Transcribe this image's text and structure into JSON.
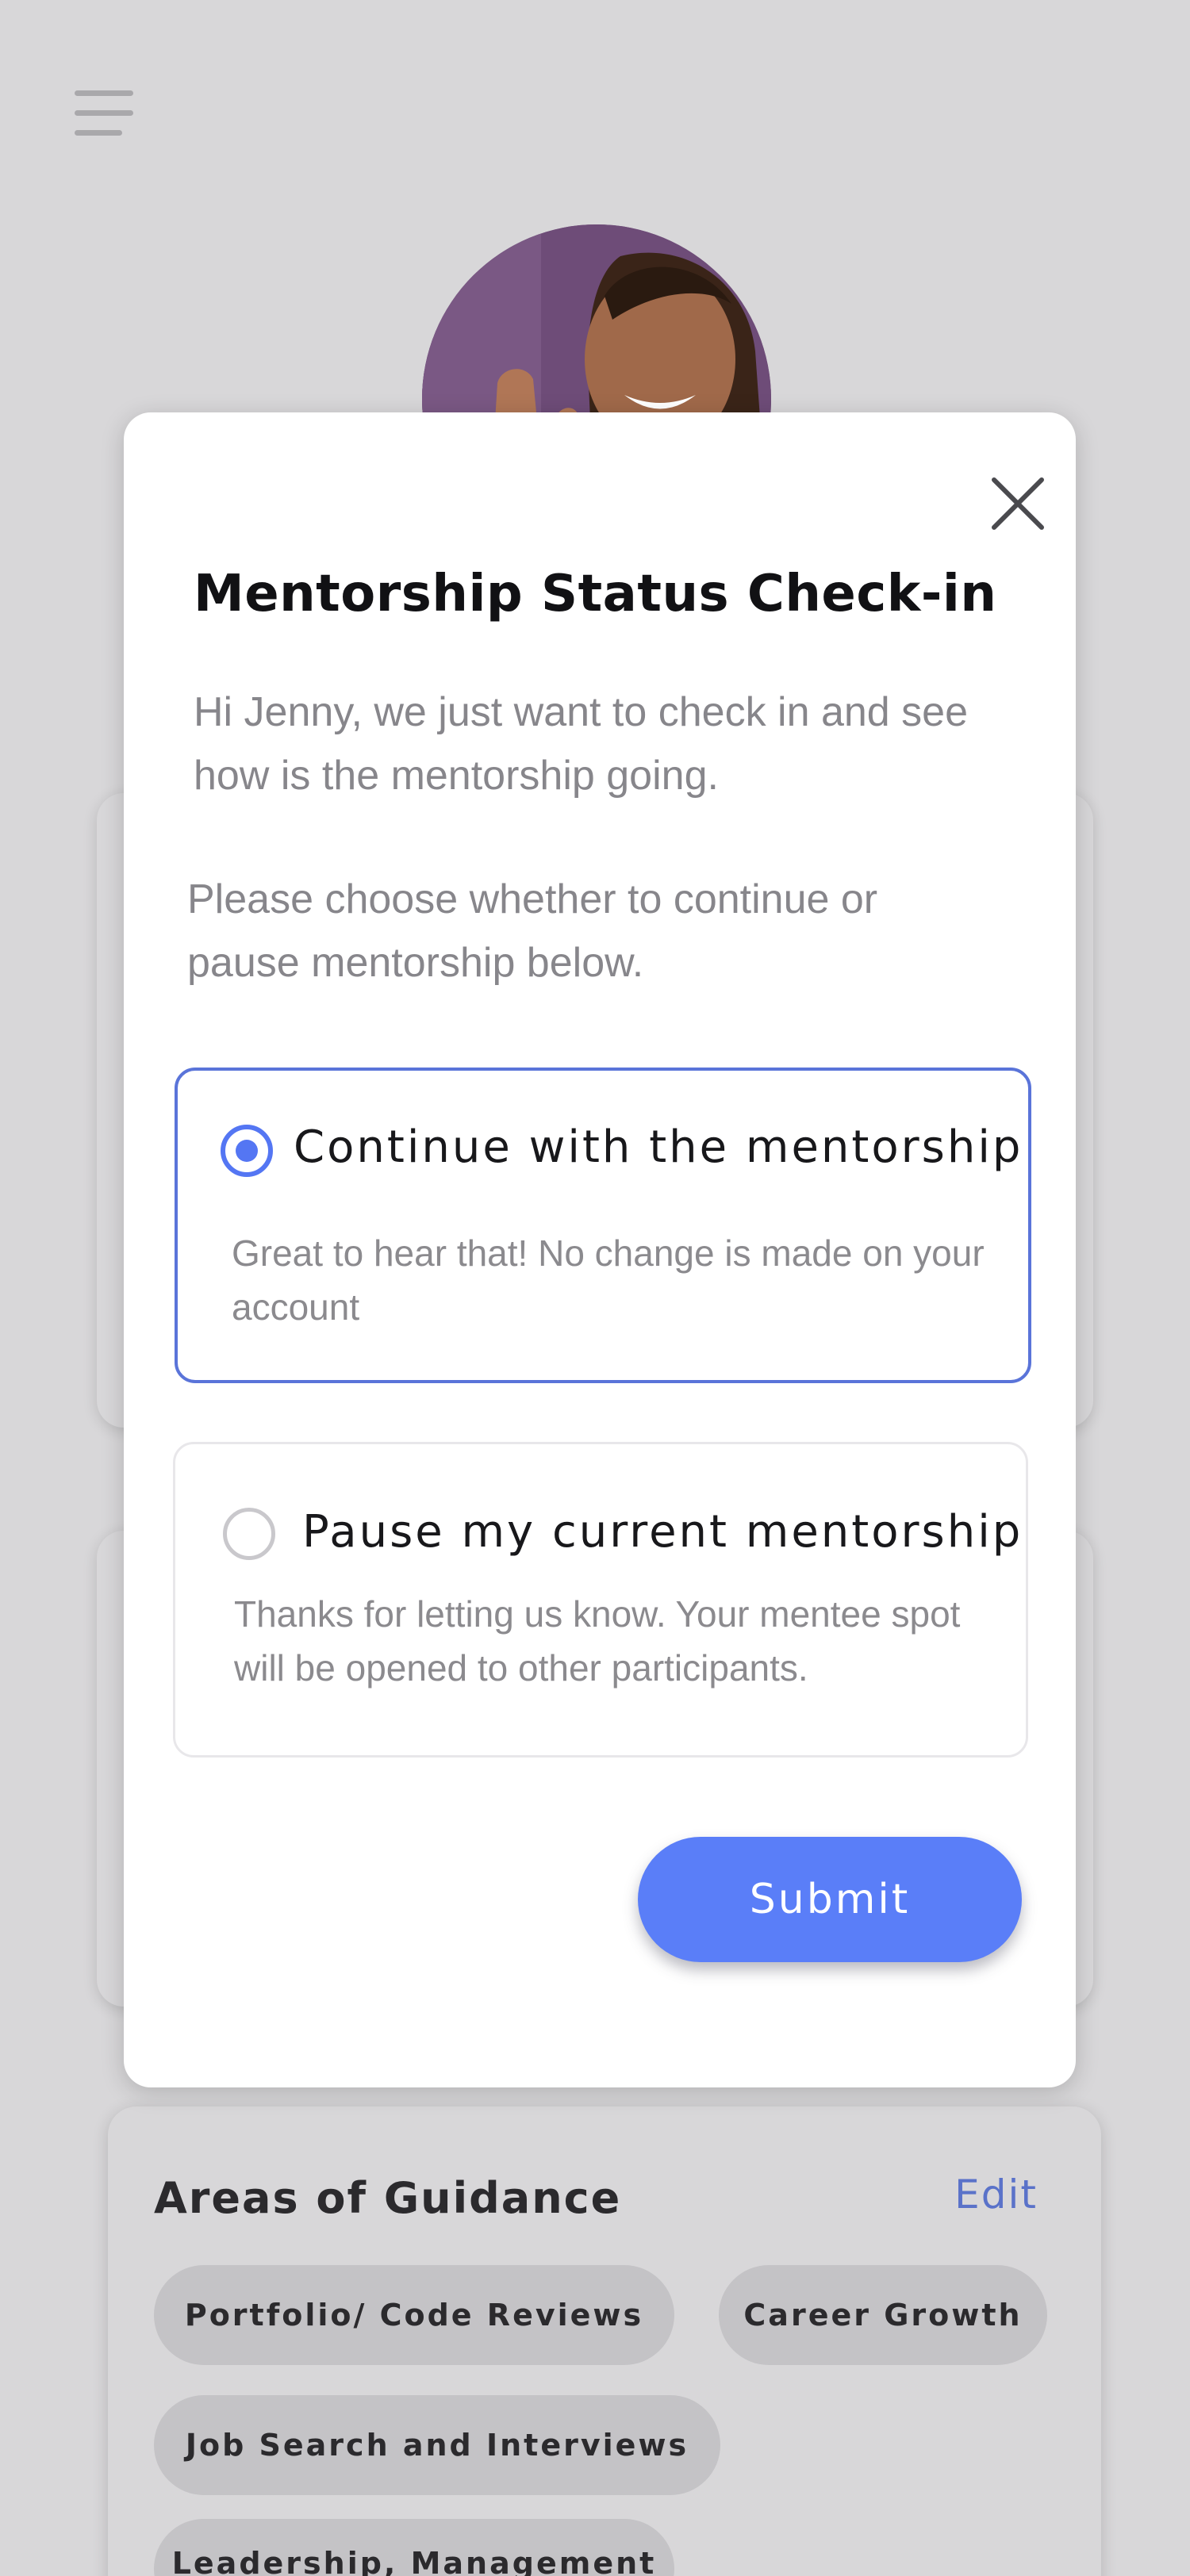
{
  "background": {
    "menu_icon": "hamburger-menu-icon",
    "avatar_icon": "user-avatar-photo",
    "areas_of_guidance": {
      "title": "Areas of Guidance",
      "edit_label": "Edit",
      "tags": [
        "Portfolio/ Code Reviews",
        "Career Growth",
        "Job Search and Interviews",
        "Leadership, Management"
      ]
    }
  },
  "modal": {
    "close_icon": "close-icon",
    "title": "Mentorship Status Check-in",
    "intro": "Hi Jenny, we just want to check in and see how is the mentorship going.",
    "instruction": "Please choose whether to continue or pause mentorship below.",
    "options": [
      {
        "label": "Continue with the mentorship",
        "description": "Great to hear that! No change is made on your account",
        "selected": true
      },
      {
        "label": "Pause my current mentorship",
        "description": "Thanks for letting us know. Your mentee spot will be opened to other participants.",
        "selected": false
      }
    ],
    "submit_label": "Submit"
  },
  "colors": {
    "accent": "#5A7EF8",
    "background": "#D8D7D9",
    "selected_border": "#5A74D9"
  }
}
